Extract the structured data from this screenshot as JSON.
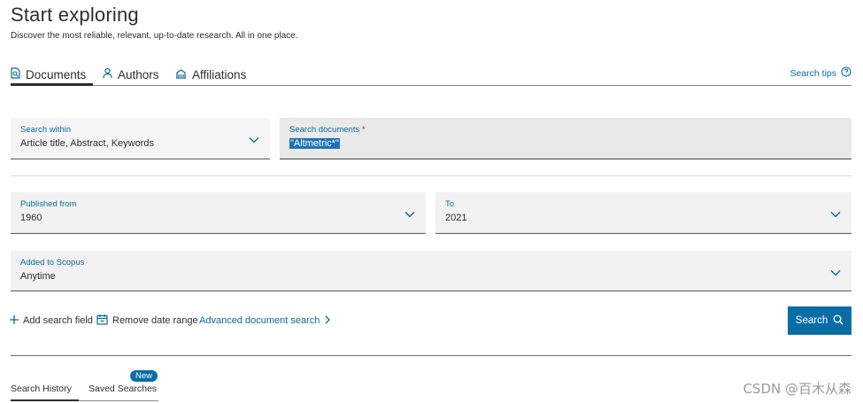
{
  "header": {
    "title": "Start exploring",
    "subtitle": "Discover the most reliable, relevant, up-to-date research. All in one place."
  },
  "tabs": [
    {
      "label": "Documents",
      "icon": "document-search-icon",
      "active": true
    },
    {
      "label": "Authors",
      "icon": "person-icon",
      "active": false
    },
    {
      "label": "Affiliations",
      "icon": "building-icon",
      "active": false
    }
  ],
  "search_tips": {
    "label": "Search tips",
    "icon": "help-circle-icon"
  },
  "fields": {
    "search_within": {
      "label": "Search within",
      "value": "Article title, Abstract, Keywords"
    },
    "search_documents": {
      "label": "Search documents",
      "required_mark": "*",
      "value": "\"Altmetric*\""
    },
    "published_from": {
      "label": "Published from",
      "value": "1960"
    },
    "published_to": {
      "label": "To",
      "value": "2021"
    },
    "added_to_scopus": {
      "label": "Added to Scopus",
      "value": "Anytime"
    }
  },
  "actions": {
    "add_field": "Add search field",
    "remove_date": "Remove date range",
    "advanced": "Advanced document search",
    "search_button": "Search"
  },
  "bottom_tabs": {
    "history": "Search History",
    "saved": "Saved Searches",
    "badge": "New"
  },
  "watermark": "CSDN @百木从森",
  "colors": {
    "accent": "#0a6ea6",
    "link": "#0a6b9c",
    "selection": "#1f72b8",
    "required": "#c8102e"
  }
}
